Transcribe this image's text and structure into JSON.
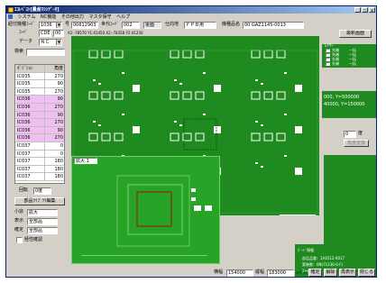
{
  "window": {
    "title": "ｴｺﾚﾍﾞｽﾄ[量産ﾏｼﾝﾃﾞｰﾀ]",
    "min_label": "_",
    "max_label": "□",
    "close_label": "×"
  },
  "menu": {
    "items": [
      "システム",
      "NC機能",
      "その他出力",
      "マスタ保守",
      "ヘルプ"
    ]
  },
  "top_fields": {
    "row1_label": "紐付機種ｺｰﾄﾞ",
    "model_code": "1036",
    "model_arrow": "▼",
    "lot_label": "号",
    "lot_value": "00612903",
    "gen_label": "世代ｺｰﾄﾞ",
    "gen_value": "002",
    "status": "後面",
    "dest_label": "仕向地",
    "dest_value": "ＦＰＢ用",
    "name_label": "機種品名",
    "name_value": "00 GAZ1145-0013",
    "latest_button": "最新画面",
    "row2_label": "ｺｰﾄﾞ",
    "code_a": "CDE",
    "code_b": "00",
    "coord_readout": "X1:-78570 Y1:41450 X2:-78358 Y2:41250",
    "data_label": "データ",
    "data_value": "ＮＣ",
    "data_arrow": "▼"
  },
  "table": {
    "search_label": "検索",
    "col1": "ﾎﾟｼﾞｼｮﾝ",
    "col2": "角度",
    "rows": [
      {
        "pos": "IC035",
        "angle": "270",
        "hi": false
      },
      {
        "pos": "IC035",
        "angle": "90",
        "hi": false
      },
      {
        "pos": "IC035",
        "angle": "270",
        "hi": false
      },
      {
        "pos": "IC036",
        "angle": "90",
        "hi": true
      },
      {
        "pos": "IC036",
        "angle": "270",
        "hi": true
      },
      {
        "pos": "IC036",
        "angle": "90",
        "hi": true
      },
      {
        "pos": "IC036",
        "angle": "270",
        "hi": true
      },
      {
        "pos": "IC036",
        "angle": "90",
        "hi": true
      },
      {
        "pos": "IC036",
        "angle": "270",
        "hi": true
      },
      {
        "pos": "IC037",
        "angle": "0",
        "hi": false
      },
      {
        "pos": "IC037",
        "angle": "0",
        "hi": false
      },
      {
        "pos": "IC037",
        "angle": "180",
        "hi": false
      },
      {
        "pos": "IC037",
        "angle": "180",
        "hi": false
      },
      {
        "pos": "IC037",
        "angle": "180",
        "hi": false
      }
    ]
  },
  "left_controls": {
    "rotate_label": "回転",
    "rotate_value": "0度",
    "parts_button": "部品ﾗｲﾌﾞﾗﾘ編集",
    "size_label": "小窓",
    "size_value": "拡大",
    "display_label": "表示",
    "display_value": "全部品",
    "confirm_label": "確定",
    "confirm_value": "全部品",
    "polarity_label": "極性確認"
  },
  "board": {
    "subwindow_label": "拡大",
    "subwindow_value": "1"
  },
  "right_panel": {
    "layer_title": "ﾚｲﾔｰ",
    "layer_items": [
      "先端",
      "先端",
      "先端",
      "先端"
    ],
    "layer_subitems": [
      "一括",
      "一括",
      "一括",
      "一括"
    ],
    "coord1": "000, Y=500000",
    "coord2": "40000, Y=150000",
    "step_value": "0",
    "step_unit": "度",
    "exec_button": "角度変換",
    "board_info_title": "ﾎﾞｰﾄﾞ情報",
    "board_info_line1": "部品品番：1A4512-0017",
    "board_info_line2": "実装数：0N(71236-0-F)",
    "board_info_line3": "2xx:135"
  },
  "bottom": {
    "width_label": "横幅",
    "width_value": "154000",
    "height_label": "縦幅",
    "height_value": "183000",
    "library_label": "ﾗｲﾌﾞﾗﾘ",
    "confirm_button": "確定",
    "release_button": "解除",
    "redraw_button": "再表示",
    "close_button": "閉じる"
  }
}
